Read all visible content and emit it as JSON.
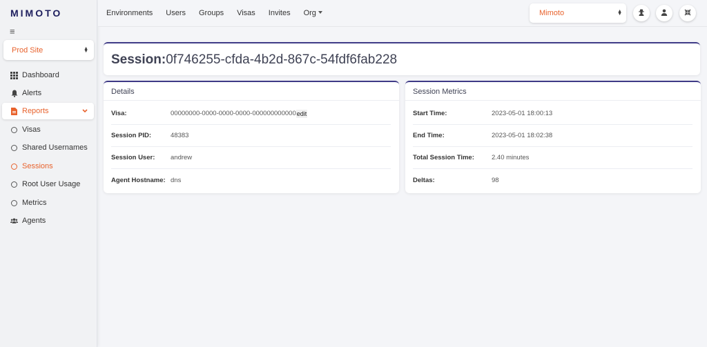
{
  "sidebar": {
    "logo": "MIMOTO",
    "site_select": "Prod Site",
    "items": [
      {
        "label": "Dashboard"
      },
      {
        "label": "Alerts"
      },
      {
        "label": "Reports"
      },
      {
        "label": "Visas"
      },
      {
        "label": "Shared Usernames"
      },
      {
        "label": "Sessions"
      },
      {
        "label": "Root User Usage"
      },
      {
        "label": "Metrics"
      },
      {
        "label": "Agents"
      }
    ]
  },
  "topnav": {
    "items": [
      "Environments",
      "Users",
      "Groups",
      "Visas",
      "Invites"
    ],
    "org_menu": "Org",
    "org_select": "Mimoto"
  },
  "page": {
    "title_label": "Session:",
    "title_value": "0f746255-cfda-4b2d-867c-54fdf6fab228"
  },
  "details": {
    "heading": "Details",
    "visa_label": "Visa:",
    "visa_value": "00000000-0000-0000-0000-000000000000",
    "visa_edit": "edit",
    "pid_label": "Session PID:",
    "pid_value": "48383",
    "user_label": "Session User:",
    "user_value": "andrew",
    "host_label": "Agent Hostname:",
    "host_value": "dns"
  },
  "metrics": {
    "heading": "Session Metrics",
    "start_label": "Start Time:",
    "start_value": "2023-05-01 18:00:13",
    "end_label": "End Time:",
    "end_value": "2023-05-01 18:02:38",
    "total_label": "Total Session Time:",
    "total_value": "2.40 minutes",
    "deltas_label": "Deltas:",
    "deltas_value": "98"
  },
  "colors": {
    "accent": "#e8622c",
    "brand": "#1e1f5e",
    "card_border": "#3e3a86"
  }
}
